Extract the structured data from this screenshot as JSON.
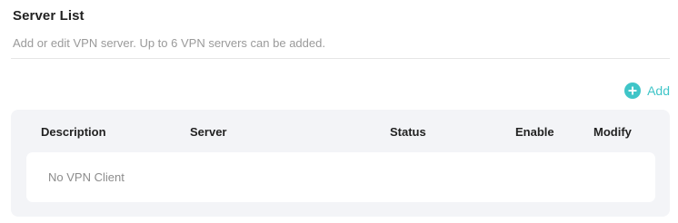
{
  "section": {
    "title": "Server List",
    "subtitle": "Add or edit VPN server. Up to 6 VPN servers can be added."
  },
  "toolbar": {
    "add_label": "Add",
    "add_icon": "plus-circle-icon"
  },
  "table": {
    "columns": [
      "Description",
      "Server",
      "Status",
      "Enable",
      "Modify"
    ],
    "rows": [],
    "empty_text": "No VPN Client"
  },
  "colors": {
    "accent": "#3fc5c8",
    "panel_background": "#f3f4f7"
  }
}
